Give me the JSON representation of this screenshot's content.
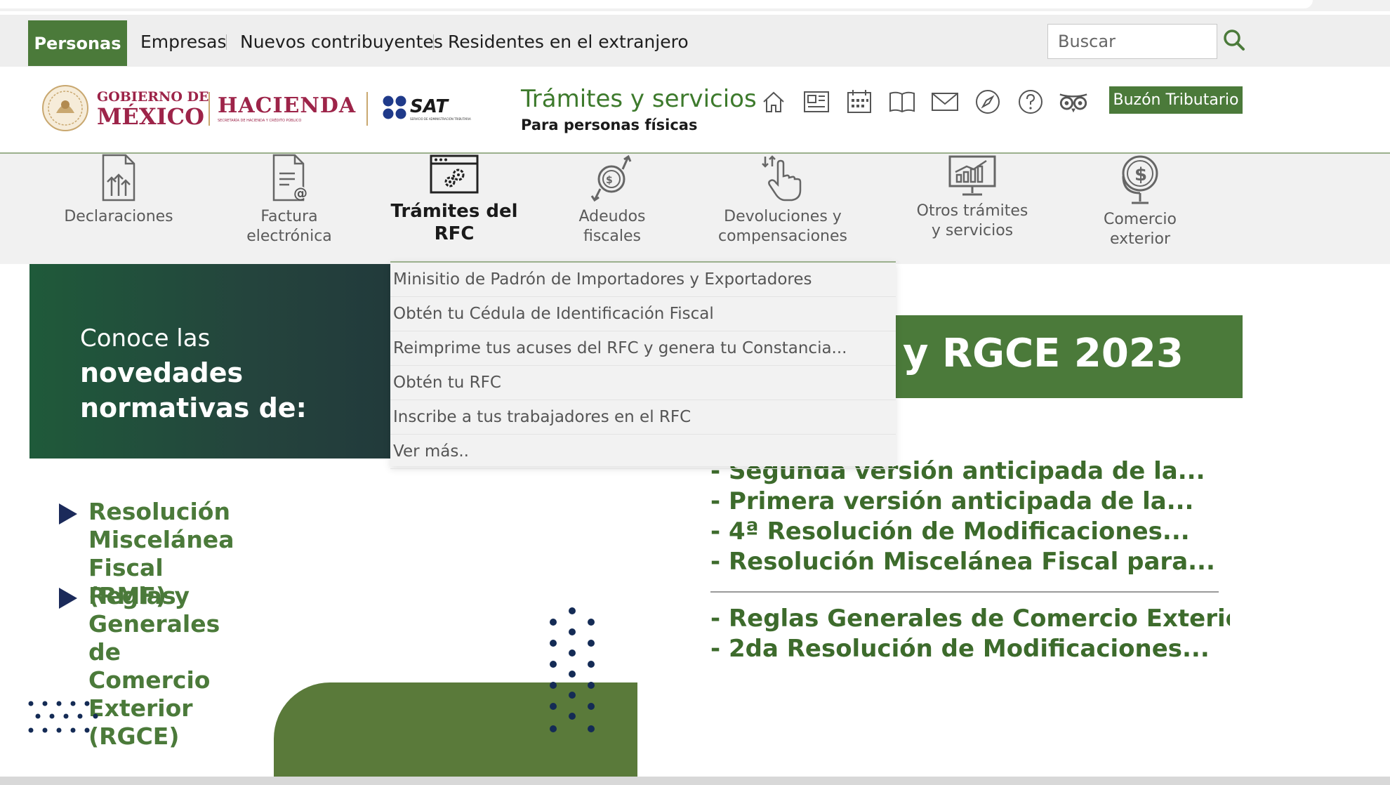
{
  "topnav": {
    "active_tab": "Personas",
    "links": [
      "Empresas",
      "Nuevos contribuyentes",
      "Residentes en el extranjero"
    ],
    "search_placeholder": "Buscar",
    "search_icon": "search-icon"
  },
  "header": {
    "logos": {
      "gobierno_line1": "GOBIERNO DE",
      "gobierno_line2": "MÉXICO",
      "hacienda": "HACIENDA",
      "hacienda_sub": "SECRETARÍA DE HACIENDA Y CRÉDITO PÚBLICO",
      "sat": "SAT",
      "sat_sub": "SERVICIO DE ADMINISTRACIÓN TRIBUTARIA"
    },
    "title": "Trámites y servicios",
    "subtitle": "Para personas físicas",
    "icons": [
      "home-icon",
      "newspaper-icon",
      "calendar-icon",
      "book-icon",
      "mail-icon",
      "compass-icon",
      "help-icon",
      "owl-icon"
    ],
    "buzon_label": "Buzón Tributario"
  },
  "categories": [
    {
      "label": "Declaraciones",
      "icon": "declaraciones-icon"
    },
    {
      "label": "Factura\nelectrónica",
      "icon": "factura-icon"
    },
    {
      "label": "Trámites del\nRFC",
      "icon": "rfc-icon",
      "active": true
    },
    {
      "label": "Adeudos\nfiscales",
      "icon": "adeudos-icon"
    },
    {
      "label": "Devoluciones y\ncompensaciones",
      "icon": "devoluciones-icon"
    },
    {
      "label": "Otros trámites\ny servicios",
      "icon": "otros-icon"
    },
    {
      "label": "Comercio\nexterior",
      "icon": "comercio-icon"
    }
  ],
  "dropdown": {
    "items": [
      "Minisitio de Padrón de Importadores y Exportadores",
      "Obtén tu Cédula de Identificación Fiscal",
      "Reimprime tus acuses del RFC y genera tu Constancia...",
      "Obtén tu RFC",
      "Inscribe a tus trabajadores en el RFC",
      "Ver más.."
    ]
  },
  "banner": {
    "left_line1": "Conoce las",
    "left_line2": "novedades\nnormativas de:",
    "right_text": "y RGCE 2023"
  },
  "bullets": [
    "Resolución Miscelánea Fiscal (RMF) y",
    "Reglas Generales de\nComercio Exterior (RGCE)"
  ],
  "rmf_list": [
    "- Segunda versión anticipada de la...",
    "- Primera versión anticipada de la...",
    "- 4ª Resolución de Modificaciones...",
    "- Resolución Miscelánea Fiscal para..."
  ],
  "rgce_list": [
    "- Reglas Generales de Comercio Exterior...",
    "- 2da Resolución de Modificaciones..."
  ],
  "colors": {
    "brand_green": "#4b7a3a",
    "dark_green": "#24443d",
    "navy": "#1b2a5a",
    "gold": "#9d2449"
  }
}
